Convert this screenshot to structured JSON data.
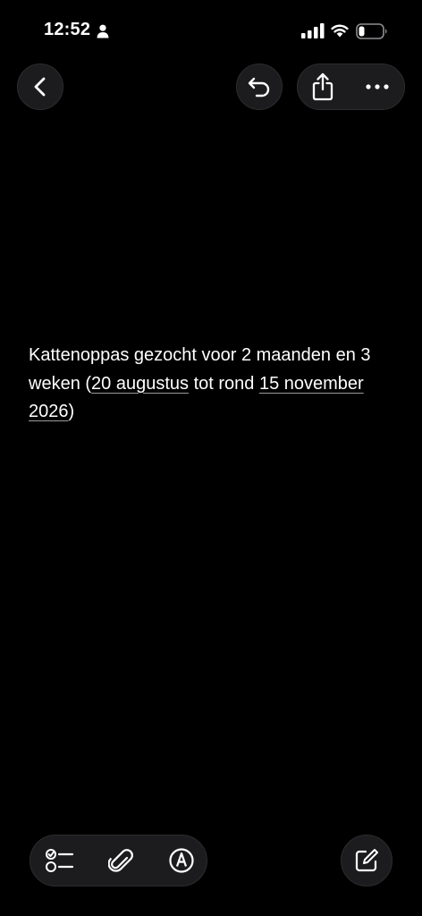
{
  "status_bar": {
    "time": "12:52",
    "icons": [
      "person-icon",
      "signal-icon",
      "wifi-icon",
      "battery-icon"
    ]
  },
  "toolbar_top": {
    "back": "chevron-left-icon",
    "undo": "undo-icon",
    "share": "share-icon",
    "more": "more-icon"
  },
  "note": {
    "part1": "Kattenoppas gezocht voor 2 maanden en 3 weken (",
    "date1": "20 augustus",
    "part2": " tot rond ",
    "date2": "15 november 2026",
    "part3": ")"
  },
  "toolbar_bottom": {
    "items": [
      "checklist-icon",
      "paperclip-icon",
      "markup-icon"
    ],
    "compose": "compose-icon"
  },
  "colors": {
    "background": "#000000",
    "button_fill": "#1c1c1e",
    "text": "#ffffff"
  }
}
